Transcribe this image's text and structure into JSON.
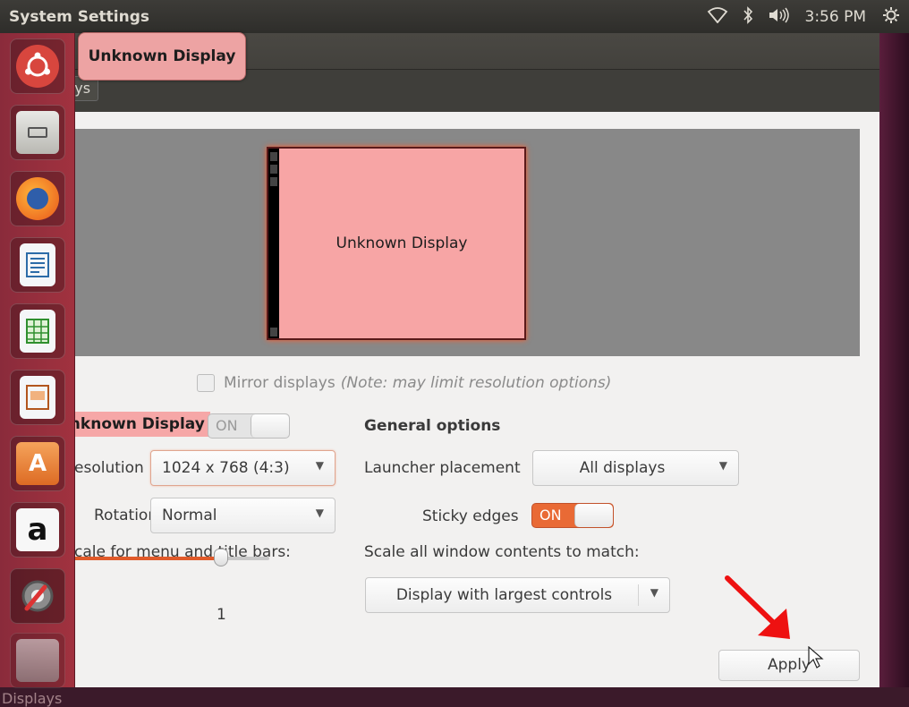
{
  "topbar": {
    "app_title": "System Settings",
    "clock": "3:56 PM",
    "icons": [
      "wifi-icon",
      "bluetooth-icon",
      "volume-icon",
      "gear-icon"
    ]
  },
  "header": {
    "breadcrumb_partial": "lays",
    "tooltip": "Unknown Display"
  },
  "arrangement": {
    "monitor_label": "Unknown Display"
  },
  "mirror": {
    "label": "Mirror displays",
    "note": "(Note: may limit resolution options)",
    "checked": false
  },
  "display": {
    "name": "Unknown Display",
    "toggle": "ON",
    "resolution_label": "esolution",
    "resolution_value": "1024 x 768 (4:3)",
    "rotation_label": "Rotation",
    "rotation_value": "Normal",
    "scale_label": "cale for menu and title bars:",
    "scale_value": "1"
  },
  "general": {
    "title": "General options",
    "launcher_label": "Launcher placement",
    "launcher_value": "All displays",
    "sticky_label": "Sticky edges",
    "sticky_toggle": "ON",
    "scale_all_label": "Scale all window contents to match:",
    "scale_all_value": "Display with largest controls"
  },
  "apply_label": "Apply",
  "launcher": {
    "items": [
      "ubuntu-dash-icon",
      "files-icon",
      "firefox-icon",
      "writer-icon",
      "calc-icon",
      "impress-icon",
      "software-center-icon",
      "amazon-icon",
      "system-settings-icon",
      "trash-icon"
    ],
    "bottom_label": "Displays"
  },
  "colors": {
    "accent": "#e96a35",
    "launcher": "#a1323f",
    "monitor": "#f7a5a5"
  }
}
